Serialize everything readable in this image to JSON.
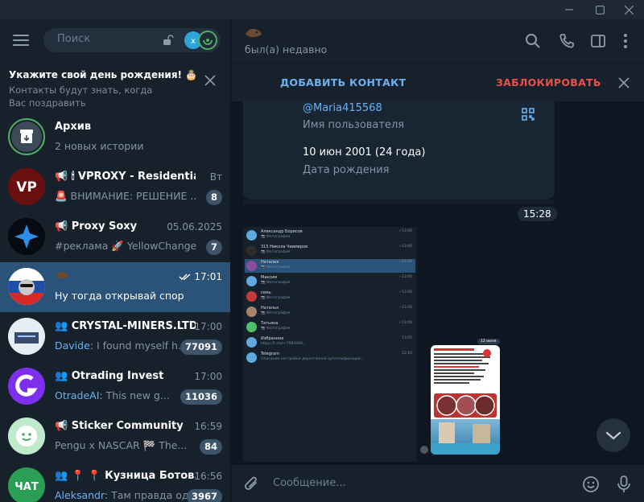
{
  "sidebar": {
    "search_placeholder": "Поиск",
    "birthday": {
      "title": "Укажите свой день рождения! 🎂",
      "subtitle": "Контакты будут знать, когда Вас поздравить"
    },
    "chats": [
      {
        "name": "Архив",
        "preview": "2 новых истории",
        "time": "",
        "badge": ""
      },
      {
        "name": "🕯 VPROXY - Residential ...",
        "preview": "🚨 ВНИМАНИЕ: РЕШЕНИЕ ...",
        "time": "Вт",
        "badge": "8"
      },
      {
        "name": "Proxy Soxy",
        "preview": "#реклама 🚀 YellowChange...",
        "time": "05.06.2025",
        "badge": "7"
      },
      {
        "name": "",
        "preview": "Ну тогда открывай спор",
        "time": "17:01",
        "badge": ""
      },
      {
        "name": "CRYSTAL-MINERS.LTD",
        "sender": "Davide:",
        "preview": " I found myself h...",
        "time": "17:00",
        "badge": "77091"
      },
      {
        "name": "Otrading Invest",
        "sender": "OtradeAI:",
        "preview": " This new g...",
        "time": "17:00",
        "badge": "11036"
      },
      {
        "name": "Sticker Community",
        "preview": " Pengu x NASCAR 🏁 The...",
        "time": "16:59",
        "badge": "84"
      },
      {
        "name": "📍 📍 Кузница Ботов...",
        "sender": "Aleksandr:",
        "preview": " Там правда одо",
        "time": "16:56",
        "badge": "3967"
      }
    ]
  },
  "header": {
    "status": "был(а) недавно"
  },
  "actionbar": {
    "add_contact": "ДОБАВИТЬ КОНТАКТ",
    "block": "ЗАБЛОКИРОВАТЬ"
  },
  "card": {
    "username": "@Maria415568",
    "username_label": "Имя пользователя",
    "birthday_value": "10 июн 2001 (24 года)",
    "birthday_label": "Дата рождения"
  },
  "message_time": "15:28",
  "mini_list": [
    {
      "name": "Александр Борисов",
      "sub": "📷 Фотография",
      "time": "✓13:06",
      "color": "#5fa8e0"
    },
    {
      "name": "315 Никола Чиимеров",
      "sub": "📷 Фотография",
      "time": "✓13:06",
      "color": "#2b2b2b"
    },
    {
      "name": "Наталия",
      "sub": "📷 Фотография",
      "time": "✓13:06",
      "color": "#8a4e9e"
    },
    {
      "name": "Максим",
      "sub": "📷 Фотография",
      "time": "✓13:06",
      "color": "#5fa8e0"
    },
    {
      "name": "семь",
      "sub": "📷 Фотография",
      "time": "✓13:06",
      "color": "#c03b3b"
    },
    {
      "name": "Наталья",
      "sub": "📷 Фотография",
      "time": "✓13:06",
      "color": "#a7856b"
    },
    {
      "name": "Татьяна",
      "sub": "📷 Фотография",
      "time": "✓13:06",
      "color": "#4fbf6b"
    },
    {
      "name": "Избранное",
      "sub": "https://t.me/+7983989...",
      "time": "13:05",
      "color": "#5fa8e0"
    },
    {
      "name": "Telegram",
      "sub": "Описание настройки двухэтапной аутентификации...",
      "time": "12:10",
      "color": "#5fa8e0"
    }
  ],
  "composer": {
    "placeholder": "Сообщение..."
  }
}
